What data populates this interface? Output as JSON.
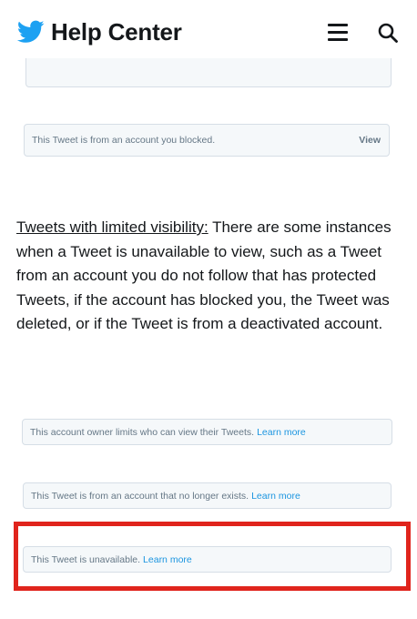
{
  "header": {
    "brand": "Help Center",
    "logo_icon": "twitter-bird-icon",
    "menu_icon": "hamburger-menu-icon",
    "search_icon": "search-icon",
    "brand_color": "#1da1f2"
  },
  "notices": {
    "blocked": {
      "text": "This Tweet is from an account you blocked.",
      "action": "View"
    },
    "limited": {
      "text": "This account owner limits who can view their Tweets.",
      "link": "Learn more"
    },
    "no_longer_exists": {
      "text": "This Tweet is from an account that no longer exists.",
      "link": "Learn more"
    },
    "unavailable": {
      "text": "This Tweet is unavailable.",
      "link": "Learn more"
    }
  },
  "article": {
    "lead": "Tweets with limited visibility:",
    "body": " There are some instances when a Tweet is unavailable to view, such as a Tweet from an account you do not follow that has protected Tweets, if the account has blocked you, the Tweet was deleted, or if the Tweet is from a deactivated account."
  },
  "colors": {
    "link": "#1b95e0",
    "highlight": "#e0241c",
    "notice_bg": "#f5f8fa"
  }
}
